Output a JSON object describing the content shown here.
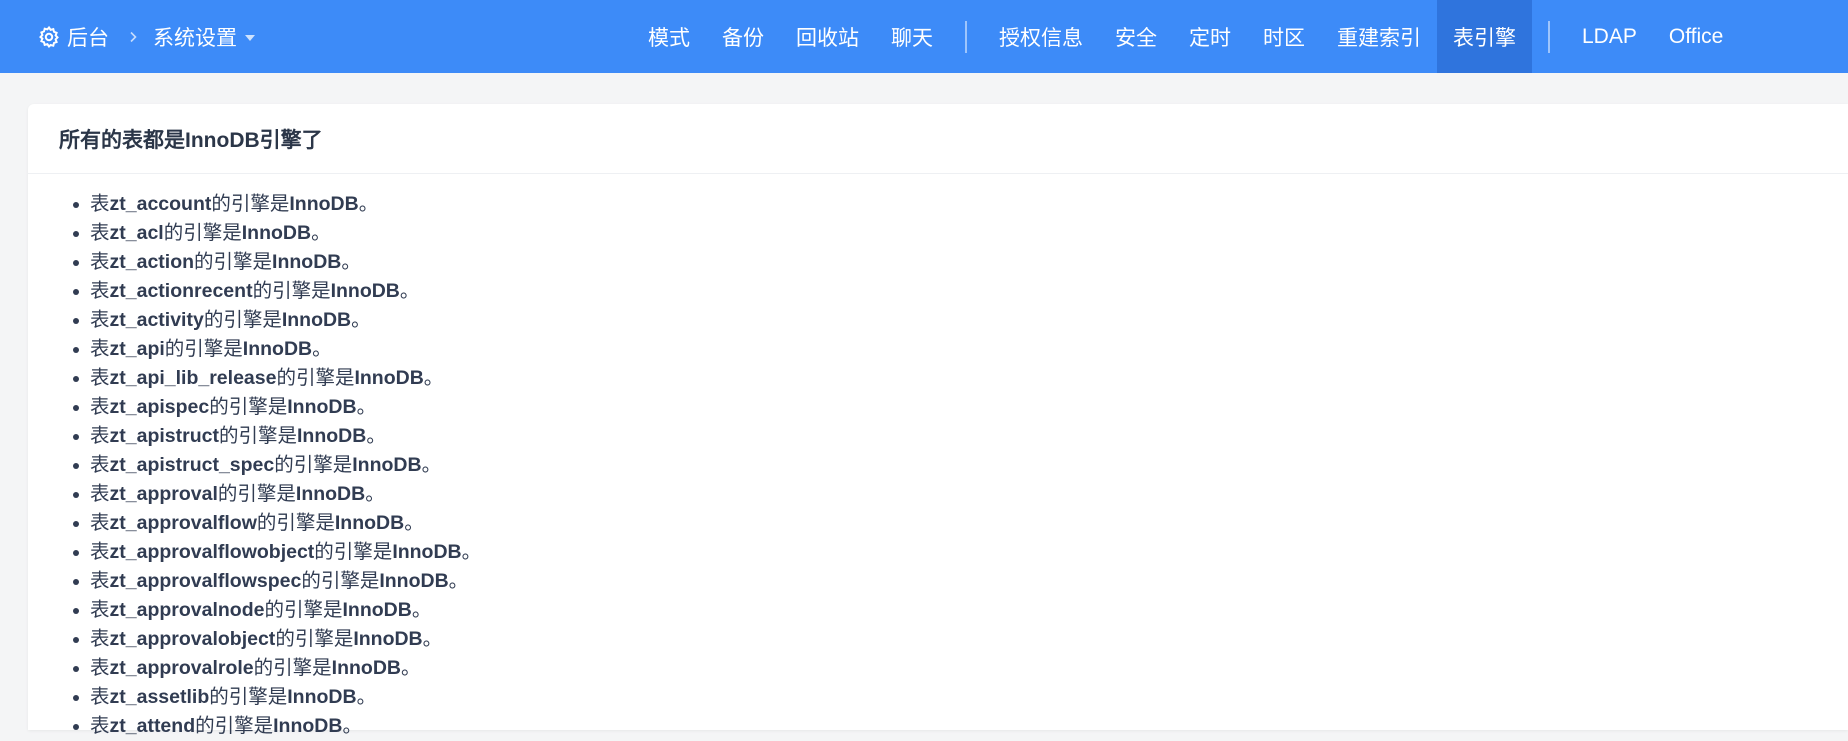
{
  "header": {
    "home_label": "后台",
    "section_label": "系统设置",
    "nav": [
      {
        "label": "模式",
        "group": 1
      },
      {
        "label": "备份",
        "group": 1
      },
      {
        "label": "回收站",
        "group": 1
      },
      {
        "label": "聊天",
        "group": 1
      },
      {
        "label": "授权信息",
        "group": 2
      },
      {
        "label": "安全",
        "group": 2
      },
      {
        "label": "定时",
        "group": 2
      },
      {
        "label": "时区",
        "group": 2
      },
      {
        "label": "重建索引",
        "group": 2
      },
      {
        "label": "表引擎",
        "group": 2,
        "active": true
      },
      {
        "label": "LDAP",
        "group": 3
      },
      {
        "label": "Office",
        "group": 3
      }
    ],
    "icons": {
      "home": "gear-icon",
      "separator": "chevron-right-icon",
      "dropdown": "caret-down-icon"
    },
    "colors": {
      "bar": "#3d8bf8",
      "active": "#2f74dd"
    }
  },
  "panel": {
    "title": "所有的表都是InnoDB引擎了",
    "prefix": "表",
    "middle": "的引擎是",
    "engine": "InnoDB",
    "suffix": "。",
    "tables": [
      "zt_account",
      "zt_acl",
      "zt_action",
      "zt_actionrecent",
      "zt_activity",
      "zt_api",
      "zt_api_lib_release",
      "zt_apispec",
      "zt_apistruct",
      "zt_apistruct_spec",
      "zt_approval",
      "zt_approvalflow",
      "zt_approvalflowobject",
      "zt_approvalflowspec",
      "zt_approvalnode",
      "zt_approvalobject",
      "zt_approvalrole",
      "zt_assetlib",
      "zt_attend"
    ]
  }
}
